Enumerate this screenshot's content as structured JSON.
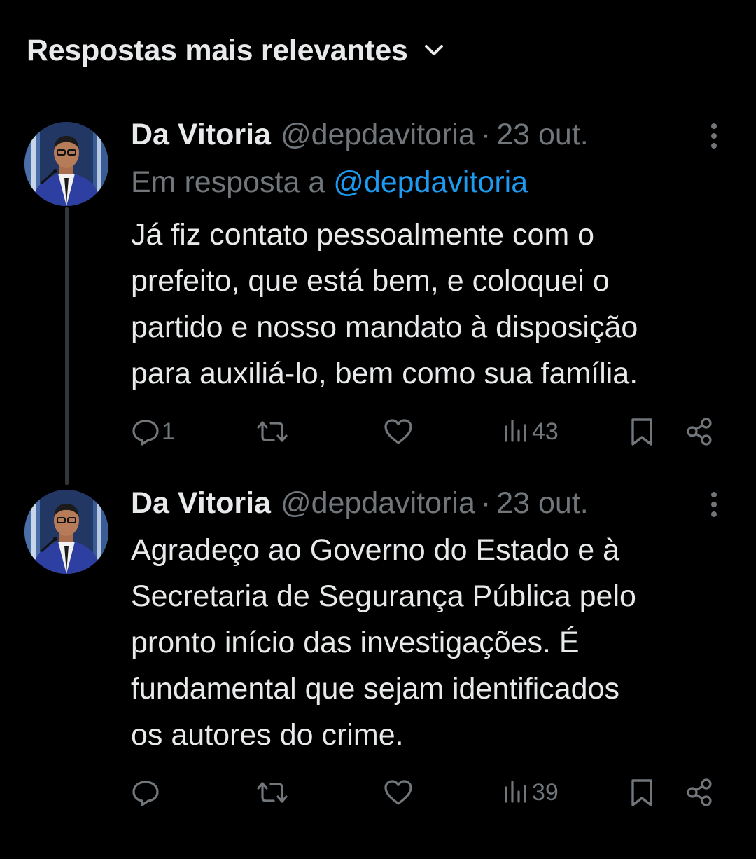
{
  "sort": {
    "label": "Respostas mais relevantes",
    "icon": "chevron-down-icon"
  },
  "colors": {
    "background": "#000000",
    "text_primary": "#e7e9ea",
    "text_secondary": "#71767b",
    "mention": "#1d9bf0",
    "thread_line": "#333639"
  },
  "tweets": [
    {
      "display_name": "Da Vitoria",
      "handle": "@depdavitoria",
      "separator": "·",
      "date": "23 out.",
      "reply_prefix": "Em resposta a",
      "reply_to": "@depdavitoria",
      "text": "Já fiz contato pessoalmente com o\nprefeito, que está bem, e coloquei o\npartido e nosso mandato à disposição\npara auxiliá-lo, bem como sua família.",
      "replies": "1",
      "reposts": "",
      "likes": "",
      "views": "43"
    },
    {
      "display_name": "Da Vitoria",
      "handle": "@depdavitoria",
      "separator": "·",
      "date": "23 out.",
      "text": "Agradeço ao Governo do Estado e à\nSecretaria de Segurança Pública pelo\npronto início das investigações. É\nfundamental que sejam identificados\nos autores do crime.",
      "replies": "",
      "reposts": "",
      "likes": "",
      "views": "39"
    }
  ]
}
